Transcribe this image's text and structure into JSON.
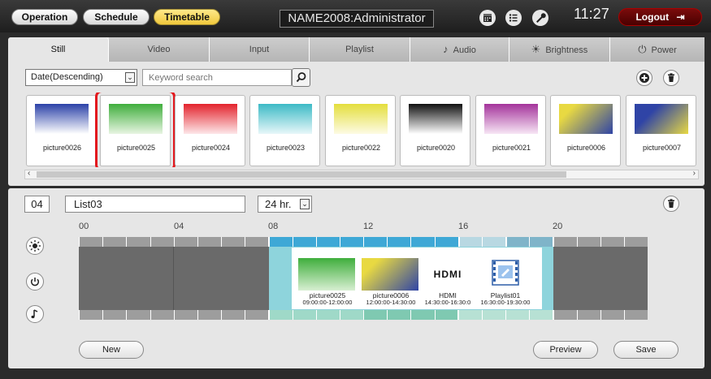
{
  "nav": {
    "operation": "Operation",
    "schedule": "Schedule",
    "timetable": "Timetable",
    "title": "NAME2008:Administrator",
    "clock": "11:27",
    "logout": "Logout"
  },
  "tabs": [
    {
      "label": "Still",
      "icon": ""
    },
    {
      "label": "Video",
      "icon": ""
    },
    {
      "label": "Input",
      "icon": ""
    },
    {
      "label": "Playlist",
      "icon": ""
    },
    {
      "label": "Audio",
      "icon": "music-note-icon"
    },
    {
      "label": "Brightness",
      "icon": "sun-icon"
    },
    {
      "label": "Power",
      "icon": "power-icon"
    }
  ],
  "toolbar": {
    "sort_value": "Date(Descending)",
    "search_placeholder": "Keyword search"
  },
  "thumbnails": [
    {
      "name": "picture0026",
      "gradient": [
        "#2b41a8",
        "#ffffff"
      ]
    },
    {
      "name": "picture0025",
      "gradient": [
        "#3fae3c",
        "#e8f5e2"
      ],
      "selected": true
    },
    {
      "name": "picture0024",
      "gradient": [
        "#e3232c",
        "#fde7e9"
      ]
    },
    {
      "name": "picture0023",
      "gradient": [
        "#3cbac6",
        "#e8f7f9"
      ]
    },
    {
      "name": "picture0022",
      "gradient": [
        "#e4de3c",
        "#fdfbe4"
      ]
    },
    {
      "name": "picture0020",
      "gradient": [
        "#111111",
        "#ffffff"
      ]
    },
    {
      "name": "picture0021",
      "gradient": [
        "#a4339b",
        "#f7e6f5"
      ]
    },
    {
      "name": "picture0006",
      "gradient": [
        "#e8d942",
        "#2f44a6"
      ]
    },
    {
      "name": "picture0007",
      "gradient": [
        "#2f44a6",
        "#e8d942"
      ]
    }
  ],
  "list": {
    "number": "04",
    "name": "List03",
    "hour_mode": "24 hr."
  },
  "hours": [
    "00",
    "04",
    "08",
    "12",
    "16",
    "20"
  ],
  "timeline_items": [
    {
      "name": "picture0025",
      "time": "09:00:00-12:00:00",
      "kind": "image",
      "gradient": [
        "#3fae3c",
        "#d8efd2"
      ]
    },
    {
      "name": "picture0006",
      "time": "12:00:00-14:30:00",
      "kind": "image",
      "gradient": [
        "#e8d942",
        "#2f44a6"
      ]
    },
    {
      "name": "HDMI",
      "time": "14:30:00-16:30:0",
      "kind": "hdmi",
      "logo": "HDMI"
    },
    {
      "name": "Playlist01",
      "time": "16:30:00-19:30:00",
      "kind": "playlist"
    }
  ],
  "buttons": {
    "new": "New",
    "preview": "Preview",
    "save": "Save"
  },
  "colors": {
    "accent_yellow": "#f0c83c",
    "logout_red": "#6a0808",
    "selection_red": "#e3191e",
    "timeline_active": "#8ed4dc",
    "timeline_strip_blue": "#3ea8d6"
  }
}
